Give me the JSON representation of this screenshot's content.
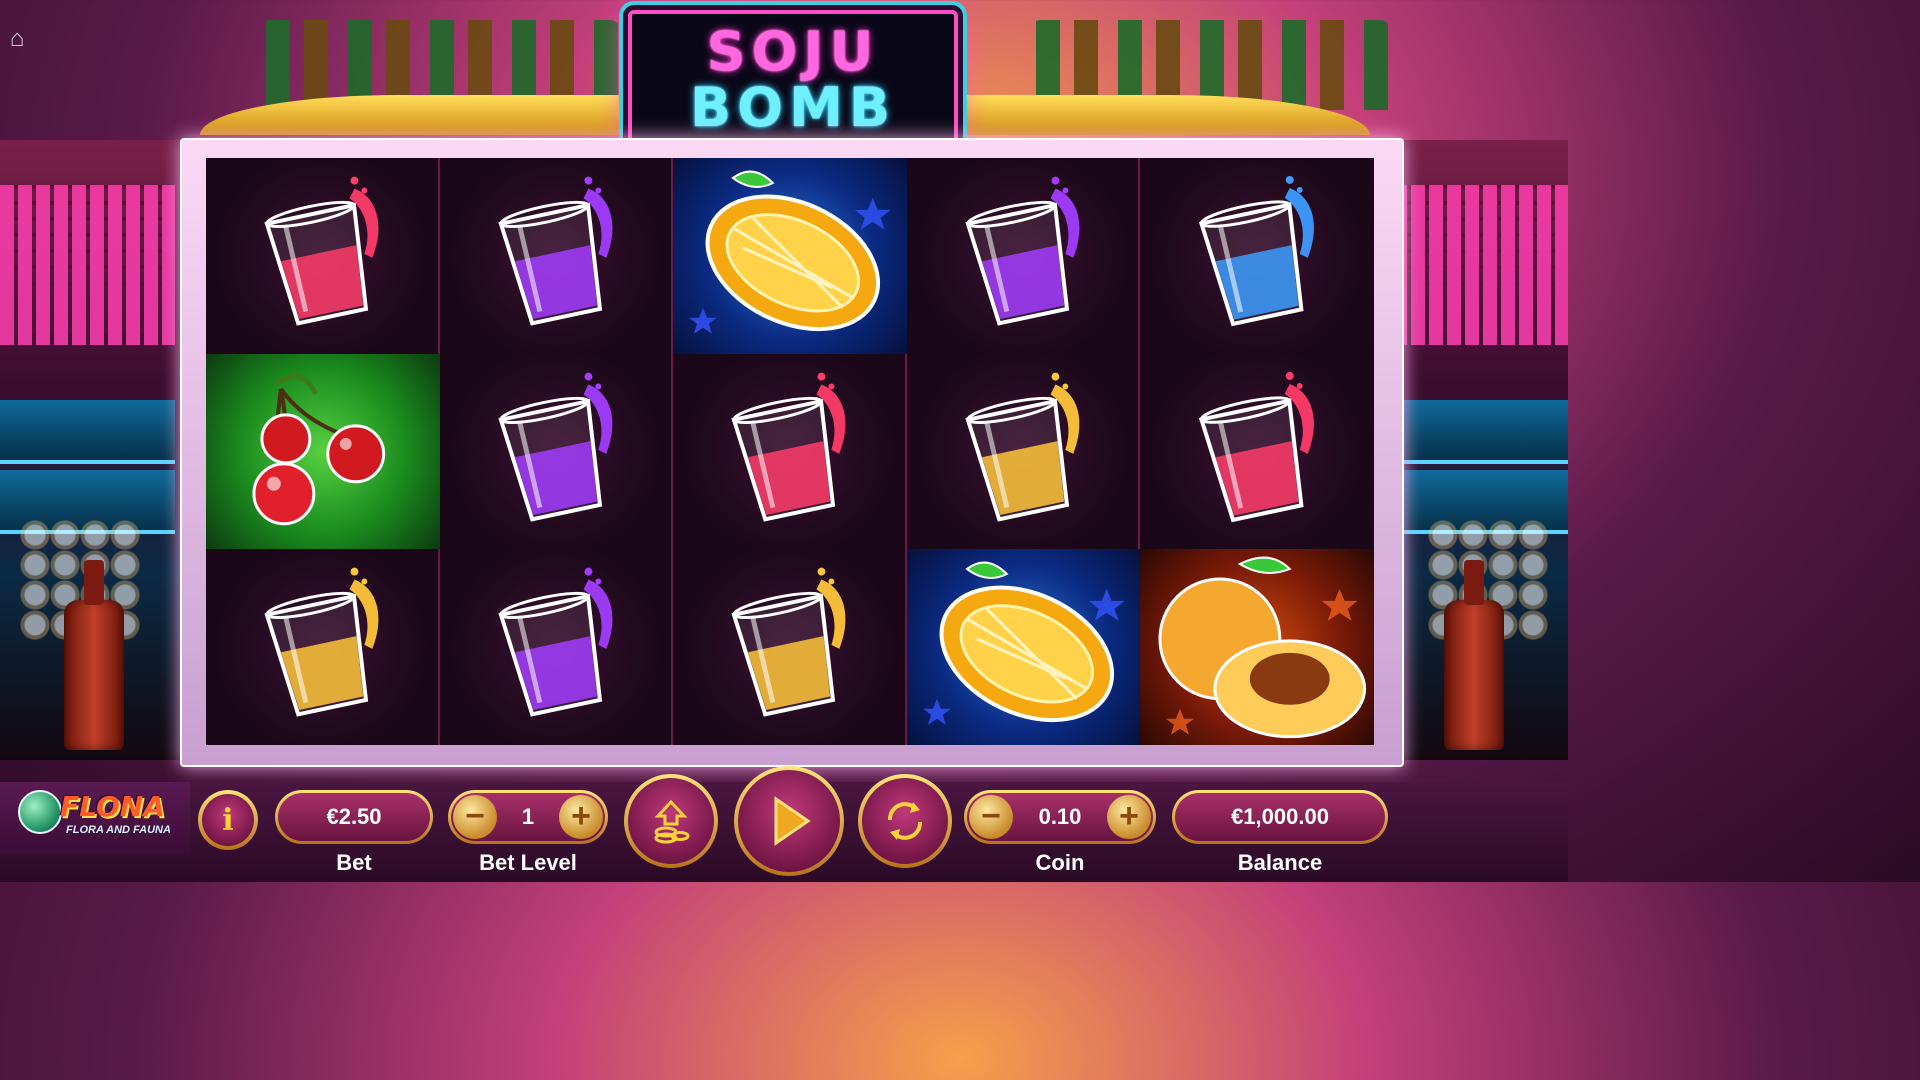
{
  "game": {
    "title_line1": "SOJU",
    "title_line2": "BOMB"
  },
  "brand": {
    "name": "FLONA",
    "tagline": "FLORA AND FAUNA"
  },
  "reels": [
    [
      "red-soju-shot",
      "cherry",
      "yellow-soju-shot"
    ],
    [
      "purple-soju-shot",
      "purple-soju-shot",
      "purple-soju-shot"
    ],
    [
      "lemon",
      "red-soju-shot",
      "yellow-soju-shot"
    ],
    [
      "purple-soju-shot",
      "yellow-soju-shot",
      "lemon"
    ],
    [
      "blue-soju-shot",
      "red-soju-shot",
      "peach"
    ]
  ],
  "symbol_colors": {
    "red-soju-shot": "#ff3c6a",
    "purple-soju-shot": "#a23cff",
    "yellow-soju-shot": "#ffc63a",
    "blue-soju-shot": "#3c9cff"
  },
  "controls": {
    "info_icon": "i",
    "bet": {
      "label": "Bet",
      "value": "€2.50"
    },
    "bet_level": {
      "label": "Bet Level",
      "value": "1",
      "minus": "−",
      "plus": "+"
    },
    "coin": {
      "label": "Coin",
      "value": "0.10",
      "minus": "−",
      "plus": "+"
    },
    "balance": {
      "label": "Balance",
      "value": "€1,000.00"
    },
    "max_bet_icon": "coin-stack-up-icon",
    "spin_icon": "play-icon",
    "autoplay_icon": "refresh-icon"
  },
  "colors": {
    "accent_gold": "#ffe37a",
    "button_magenta": "#a8306a",
    "logo_pink": "#ff66e0",
    "logo_cyan": "#6ff0ff"
  }
}
